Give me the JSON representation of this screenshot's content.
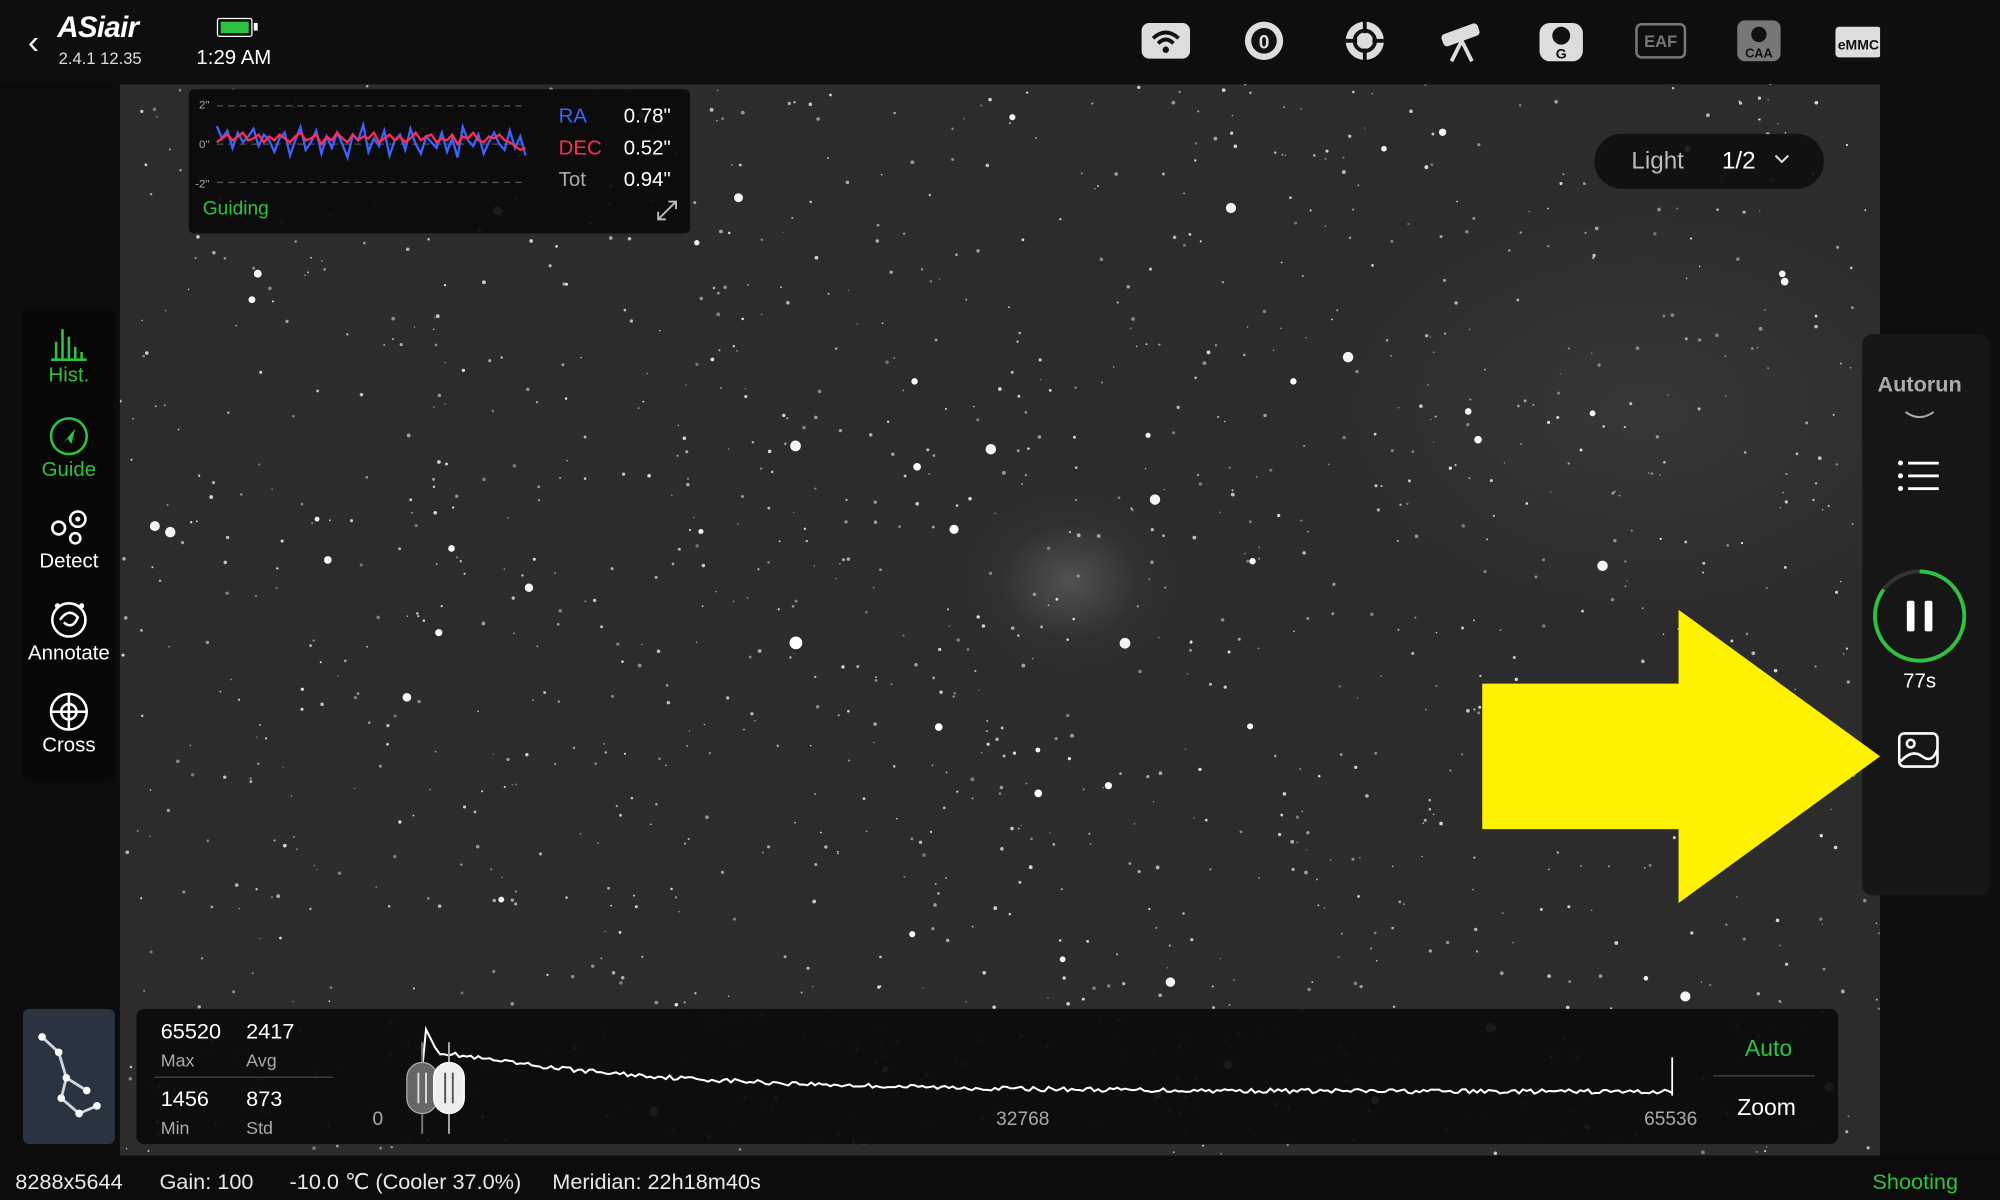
{
  "header": {
    "logo": "ASiair",
    "version": "2.4.1 12.35",
    "time": "1:29 AM",
    "icons": [
      "wifi-icon",
      "filter-wheel-icon",
      "guide-target-icon",
      "telescope-icon",
      "guide-camera-icon",
      "eaf-icon",
      "caa-icon",
      "emmc-icon",
      "info-icon"
    ],
    "eaf_label": "EAF",
    "caa_label": "CAA",
    "emmc_label": "eMMC",
    "guide_cam_label": "G",
    "filter_label": "0"
  },
  "guiding": {
    "status": "Guiding",
    "axis_top": "2\"",
    "axis_mid": "0\"",
    "axis_bottom": "-2\"",
    "ra_label": "RA",
    "ra_value": "0.78\"",
    "dec_label": "DEC",
    "dec_value": "0.52\"",
    "tot_label": "Tot",
    "tot_value": "0.94\"",
    "colors": {
      "ra": "#3b63ff",
      "dec": "#ff2d55",
      "status": "#2ec240"
    },
    "ra_series": [
      0.95,
      0.3,
      0.7,
      -0.2,
      0.6,
      0.1,
      0.4,
      0.8,
      -0.1,
      0.5,
      0.2,
      -0.4,
      0.3,
      0.6,
      -0.6,
      0.2,
      0.9,
      -0.3,
      0.1,
      0.7,
      -0.5,
      0.4,
      -0.2,
      0.6,
      0.0,
      -0.7,
      0.5,
      0.2,
      1.0,
      -0.4,
      0.3,
      -0.1,
      0.7,
      -0.6,
      0.2,
      0.5,
      -0.3,
      0.8,
      0.0,
      -0.5,
      0.4,
      0.1,
      -0.2,
      0.6,
      -0.4,
      0.3,
      -0.7,
      0.9,
      0.2,
      -0.1,
      0.5,
      -0.5,
      0.1,
      0.6,
      0.0,
      -0.3,
      0.7,
      -0.2,
      0.4,
      -0.6
    ],
    "dec_series": [
      0.1,
      0.3,
      0.5,
      0.2,
      0.4,
      0.6,
      0.2,
      0.3,
      0.5,
      0.1,
      0.4,
      0.2,
      0.5,
      0.3,
      0.1,
      0.4,
      0.6,
      0.2,
      0.3,
      0.5,
      0.0,
      0.4,
      0.2,
      0.6,
      0.3,
      0.1,
      0.5,
      0.2,
      0.4,
      0.3,
      0.6,
      0.1,
      0.3,
      0.5,
      0.2,
      0.4,
      0.1,
      0.3,
      0.6,
      0.2,
      0.4,
      0.5,
      0.1,
      0.3,
      0.2,
      0.5,
      0.0,
      0.4,
      0.3,
      0.6,
      0.2,
      0.1,
      0.4,
      0.3,
      0.5,
      0.2,
      0.1,
      -0.1,
      -0.3,
      -0.2
    ]
  },
  "frame_selector": {
    "type": "Light",
    "count": "1/2"
  },
  "left_menu": [
    {
      "id": "hist",
      "label": "Hist.",
      "active": true
    },
    {
      "id": "guide",
      "label": "Guide",
      "active": true
    },
    {
      "id": "detect",
      "label": "Detect",
      "active": false
    },
    {
      "id": "annotate",
      "label": "Annotate",
      "active": false
    },
    {
      "id": "cross",
      "label": "Cross",
      "active": false
    }
  ],
  "autorun": {
    "title": "Autorun",
    "countdown": "77s",
    "progress": 0.85
  },
  "histogram": {
    "max_value": "65520",
    "max_label": "Max",
    "avg_value": "2417",
    "avg_label": "Avg",
    "min_value": "1456",
    "min_label": "Min",
    "std_value": "873",
    "std_label": "Std",
    "axis_start": "0",
    "axis_mid": "32768",
    "axis_end": "65536",
    "auto_label": "Auto",
    "zoom_label": "Zoom"
  },
  "status_bar": {
    "resolution": "8288x5644",
    "gain": "Gain: 100",
    "temperature": "-10.0 ℃ (Cooler 37.0%)",
    "meridian": "Meridian: 22h18m40s",
    "state": "Shooting"
  },
  "colors": {
    "accent": "#2ec240",
    "annotation_arrow": "#fff200"
  }
}
